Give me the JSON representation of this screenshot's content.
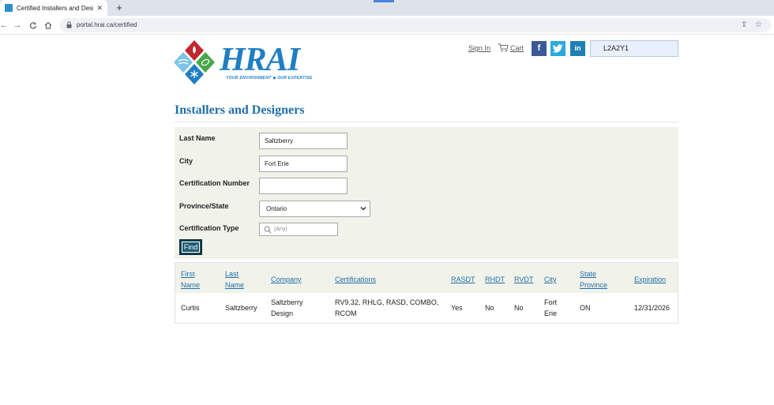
{
  "browser": {
    "tab_title": "Certified Installers and Designe",
    "tab_close": "✕",
    "new_tab": "+",
    "url": "portal.hrai.ca/certified"
  },
  "header": {
    "logo_text": "HRAI",
    "logo_tagline": "YOUR ENVIRONMENT ◆ OUR EXPERTISE",
    "sign_in": "Sign In",
    "cart": "Cart",
    "social": [
      "f",
      "t",
      "in"
    ],
    "search_value": "L2A2Y1"
  },
  "page": {
    "title": "Installers and Designers"
  },
  "form": {
    "fields": [
      {
        "label": "Last Name",
        "value": "Saltzberry"
      },
      {
        "label": "City",
        "value": "Fort Erie"
      },
      {
        "label": "Certification Number",
        "value": ""
      },
      {
        "label": "Province/State",
        "value": "Ontario"
      },
      {
        "label": "Certification Type",
        "placeholder": "(Any)"
      }
    ],
    "find_label": "Find"
  },
  "results": {
    "headers": [
      [
        "First",
        "Name"
      ],
      [
        "Last",
        "Name"
      ],
      [
        "Company"
      ],
      [
        "Certifications"
      ],
      [
        "RASDT"
      ],
      [
        "RHDT"
      ],
      [
        "RVDT"
      ],
      [
        "City"
      ],
      [
        "State",
        "Province"
      ],
      [
        "Expiration"
      ]
    ],
    "rows": [
      [
        [
          "Curtis"
        ],
        [
          "Saltzberry"
        ],
        [
          "Saltzberry",
          "Design"
        ],
        [
          "RV9.32, RHLG, RASD, COMBO,",
          "RCOM"
        ],
        [
          "Yes"
        ],
        [
          "No"
        ],
        [
          "No"
        ],
        [
          "Fort",
          "Erie"
        ],
        [
          "ON"
        ],
        [
          "12/31/2026"
        ]
      ]
    ]
  },
  "colors": {
    "brand_blue": "#1f7ec3",
    "heading_blue": "#1f6fa8",
    "panel_bg": "#f1f2ea",
    "find_button": "#1e5b73"
  },
  "icons": [
    "reload-icon",
    "home-icon",
    "lock-icon",
    "share-icon",
    "star-icon",
    "cart-icon",
    "search-icon",
    "chevron-down-icon"
  ]
}
